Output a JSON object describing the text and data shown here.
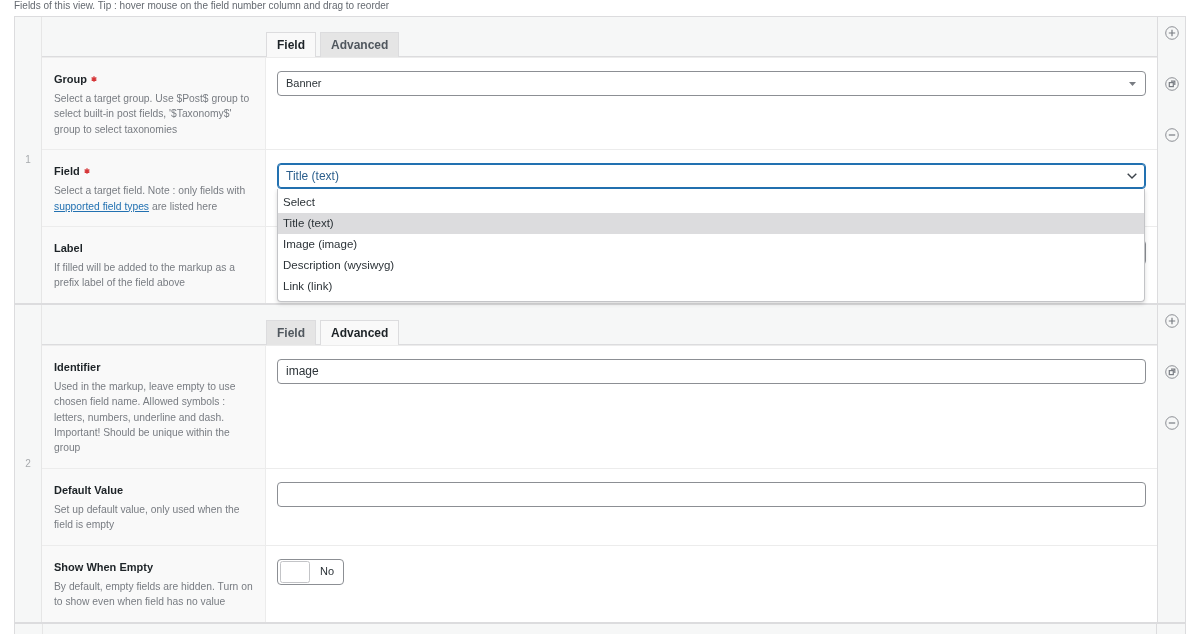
{
  "intro": "Fields of this view. Tip : hover mouse on the field number column and drag to reorder",
  "fields": [
    {
      "number": "1",
      "tabs": [
        {
          "label": "Field",
          "selected": true
        },
        {
          "label": "Advanced",
          "selected": false
        }
      ],
      "settings": [
        {
          "kind": "combo",
          "label": "Group",
          "required": true,
          "description": [
            {
              "kind": "text",
              "text": "Select a target group. Use $Post$ group to select built-in post fields, '$Taxonomy$' group to select taxonomies"
            }
          ],
          "value": "Banner"
        },
        {
          "kind": "select",
          "label": "Field",
          "required": true,
          "description": [
            {
              "kind": "text",
              "text": "Select a target field. Note : only fields with"
            },
            {
              "kind": "link",
              "text": "supported field types"
            },
            {
              "kind": "text",
              "text": "are listed here"
            }
          ],
          "value": "Title (text)",
          "focused": true,
          "open": true,
          "options": [
            {
              "label": "Select",
              "selected": false
            },
            {
              "label": "Title (text)",
              "selected": true
            },
            {
              "label": "Image (image)",
              "selected": false
            },
            {
              "label": "Description (wysiwyg)",
              "selected": false
            },
            {
              "label": "Link (link)",
              "selected": false
            }
          ]
        },
        {
          "kind": "text",
          "label": "Label",
          "required": false,
          "description": [
            {
              "kind": "text",
              "text": "If filled will be added to the markup as a prefix label of the field above"
            }
          ]
        }
      ]
    },
    {
      "number": "2",
      "tabs": [
        {
          "label": "Field",
          "selected": false
        },
        {
          "label": "Advanced",
          "selected": true
        }
      ],
      "settings": [
        {
          "kind": "text",
          "label": "Identifier",
          "required": false,
          "description": [
            {
              "kind": "text",
              "text": "Used in the markup, leave empty to use chosen field name. Allowed symbols : letters, numbers, underline and dash. Important! Should be unique within the group"
            }
          ],
          "value": "image"
        },
        {
          "kind": "text",
          "label": "Default Value",
          "required": false,
          "description": [
            {
              "kind": "text",
              "text": "Set up default value, only used when the field is empty"
            }
          ]
        },
        {
          "kind": "toggle",
          "label": "Show When Empty",
          "required": false,
          "description": [
            {
              "kind": "text",
              "text": "By default, empty fields are hidden. Turn on to show even when field has no value"
            }
          ],
          "on": false,
          "state_text": "No"
        }
      ]
    }
  ]
}
